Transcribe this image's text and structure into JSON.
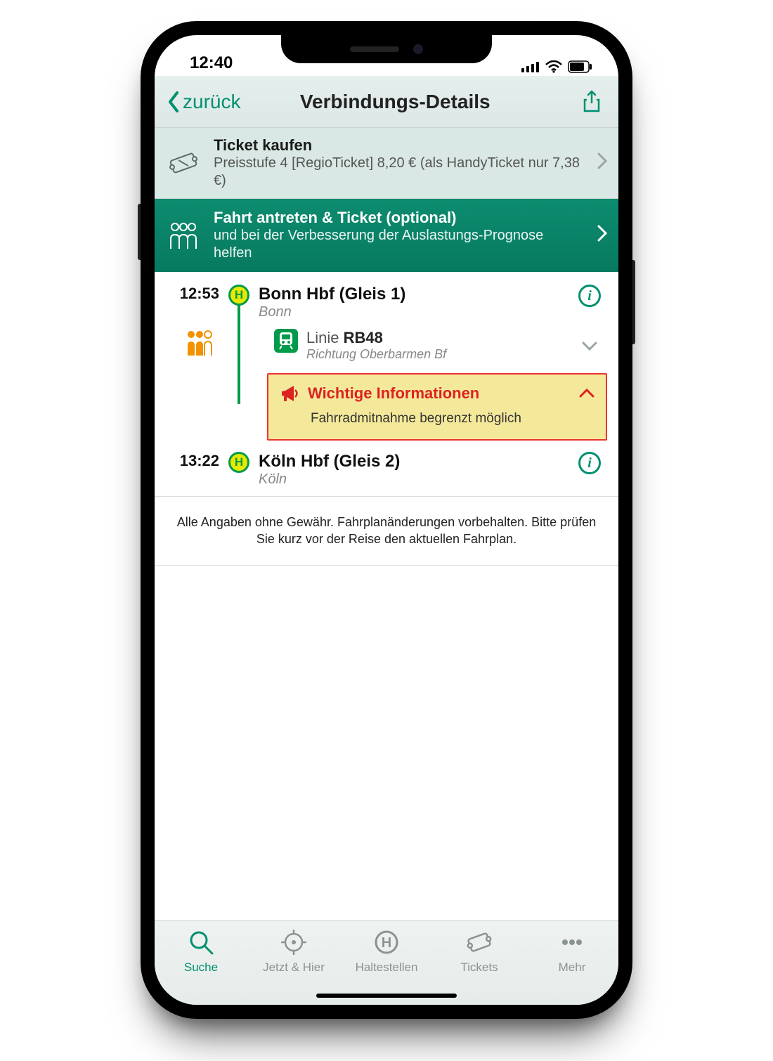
{
  "status_bar": {
    "time": "12:40"
  },
  "nav": {
    "back": "zurück",
    "title": "Verbindungs-Details"
  },
  "buy_ticket": {
    "title": "Ticket kaufen",
    "subtitle": "Preisstufe 4 [RegioTicket] 8,20 € (als HandyTicket nur 7,38 €)"
  },
  "start_trip": {
    "title": "Fahrt antreten & Ticket (optional)",
    "subtitle": "und bei der Verbesserung der Auslastungs-Prognose helfen"
  },
  "journey": {
    "dep_time": "12:53",
    "dep_stop": "Bonn Hbf (Gleis 1)",
    "dep_city": "Bonn",
    "line_prefix": "Linie",
    "line": "RB48",
    "direction": "Richtung Oberbarmen Bf",
    "arr_time": "13:22",
    "arr_stop": "Köln Hbf (Gleis 2)",
    "arr_city": "Köln"
  },
  "alert": {
    "title": "Wichtige Informationen",
    "body": "Fahrradmitnahme begrenzt möglich"
  },
  "disclaimer": "Alle Angaben ohne Gewähr. Fahrplanänderungen vorbehalten. Bitte prüfen Sie kurz vor der Reise den aktuellen Fahrplan.",
  "tabs": {
    "search": "Suche",
    "now": "Jetzt & Hier",
    "stops": "Haltestellen",
    "tickets": "Tickets",
    "more": "Mehr"
  },
  "h_letter": "H"
}
